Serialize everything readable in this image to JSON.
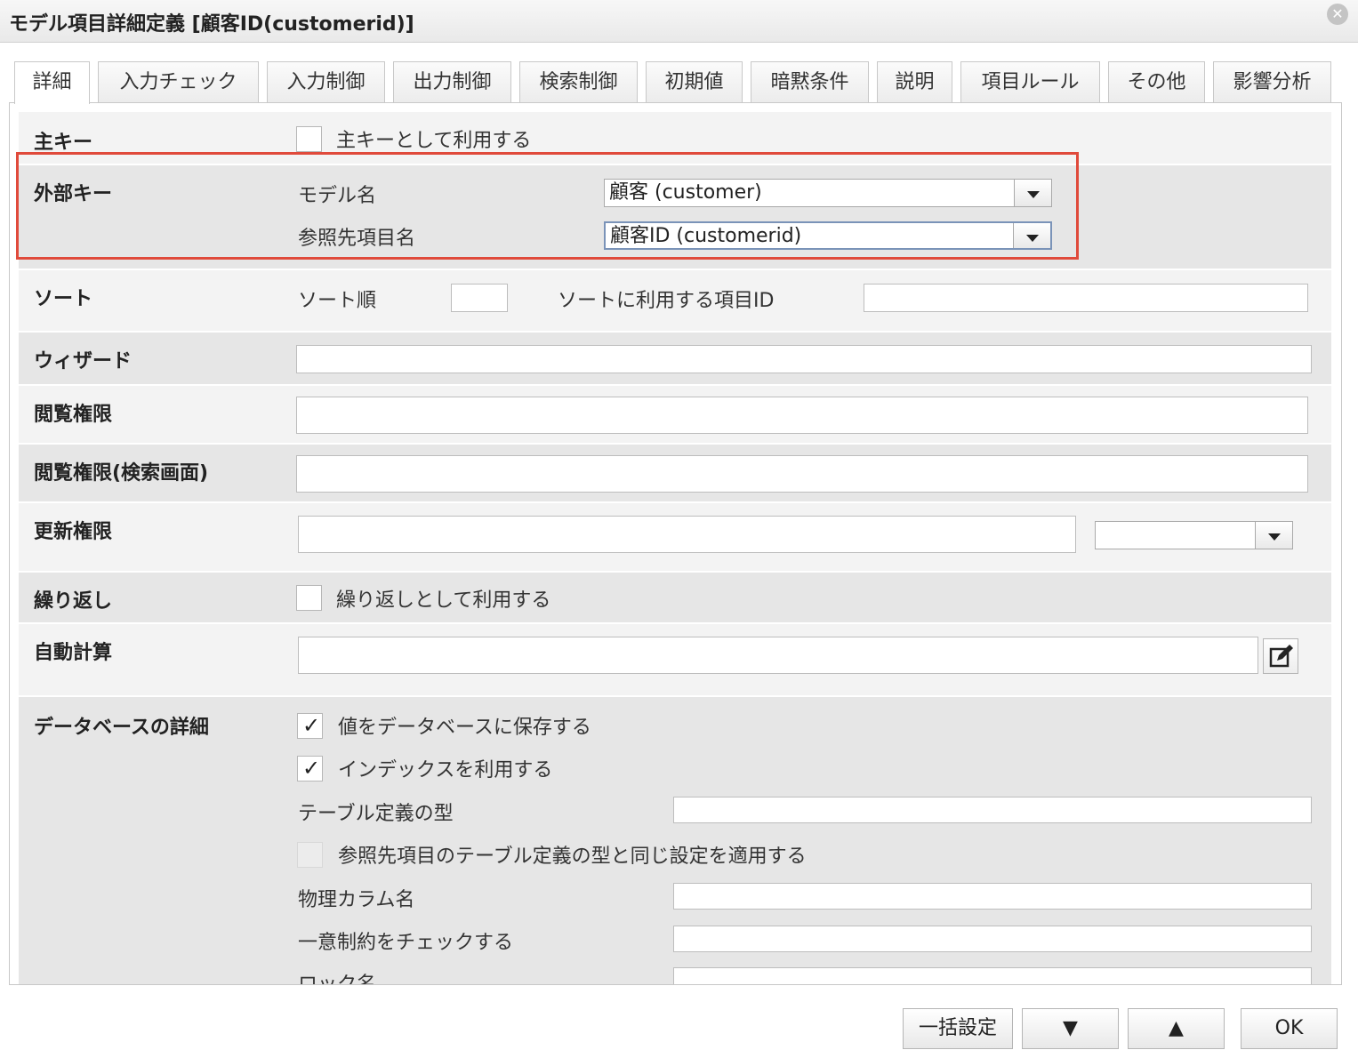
{
  "dialog": {
    "title": "モデル項目詳細定義 [顧客ID(customerid)]"
  },
  "tabs": [
    {
      "label": "詳細",
      "active": true
    },
    {
      "label": "入力チェック"
    },
    {
      "label": "入力制御"
    },
    {
      "label": "出力制御"
    },
    {
      "label": "検索制御"
    },
    {
      "label": "初期値"
    },
    {
      "label": "暗黙条件"
    },
    {
      "label": "説明"
    },
    {
      "label": "項目ルール"
    },
    {
      "label": "その他"
    },
    {
      "label": "影響分析"
    }
  ],
  "primary_key": {
    "label": "主キー",
    "checkbox_label": "主キーとして利用する",
    "checked": false
  },
  "foreign_key": {
    "label": "外部キー",
    "model_name_label": "モデル名",
    "model_name_value": "顧客 (customer)",
    "ref_item_label": "参照先項目名",
    "ref_item_value": "顧客ID (customerid)"
  },
  "sort": {
    "label": "ソート",
    "order_label": "ソート順",
    "order_value": "",
    "item_id_label": "ソートに利用する項目ID",
    "item_id_value": ""
  },
  "wizard": {
    "label": "ウィザード",
    "value": ""
  },
  "view_permission": {
    "label": "閲覧権限",
    "value": ""
  },
  "view_permission_search": {
    "label": "閲覧権限(検索画面)",
    "value": ""
  },
  "update_permission": {
    "label": "更新権限",
    "value": "",
    "select_value": ""
  },
  "repeat": {
    "label": "繰り返し",
    "checkbox_label": "繰り返しとして利用する",
    "checked": false
  },
  "auto_calc": {
    "label": "自動計算",
    "value": "",
    "edit_icon": "edit-icon"
  },
  "database": {
    "label": "データベースの詳細",
    "save_label": "値をデータベースに保存する",
    "save_checked": true,
    "index_label": "インデックスを利用する",
    "index_checked": true,
    "table_type_label": "テーブル定義の型",
    "table_type_value": "",
    "same_setting_label": "参照先項目のテーブル定義の型と同じ設定を適用する",
    "same_setting_checked": false,
    "physical_column_label": "物理カラム名",
    "physical_column_value": "",
    "unique_label": "一意制約をチェックする",
    "unique_value": "",
    "lock_label": "ロック名",
    "lock_value": ""
  },
  "footer": {
    "bulk_label": "一括設定",
    "down_label": "▼",
    "up_label": "▲",
    "ok_label": "OK"
  },
  "colors": {
    "highlight": "#e04a3b",
    "row_light": "#f3f3f3",
    "row_dark": "#e6e6e6"
  }
}
